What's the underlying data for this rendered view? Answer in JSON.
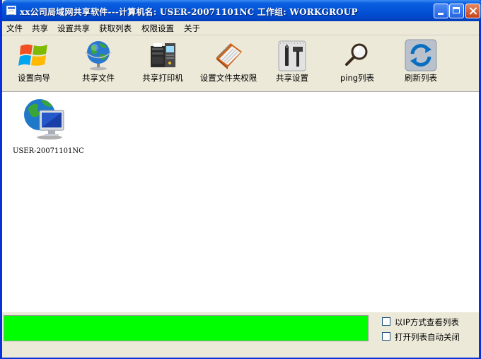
{
  "window": {
    "title": "xx公司局域网共享软件---计算机名: USER-20071101NC   工作组: WORKGROUP"
  },
  "menu": [
    "文件",
    "共享",
    "设置共享",
    "获取列表",
    "权限设置",
    "关于"
  ],
  "toolbar": [
    {
      "label": "设置向导",
      "icon": "windows-logo-icon"
    },
    {
      "label": "共享文件",
      "icon": "globe-icon"
    },
    {
      "label": "共享打印机",
      "icon": "printer-server-icon"
    },
    {
      "label": "设置文件夹权限",
      "icon": "notebook-icon"
    },
    {
      "label": "共享设置",
      "icon": "tools-icon"
    },
    {
      "label": "ping列表",
      "icon": "magnifier-icon"
    },
    {
      "label": "刷新列表",
      "icon": "refresh-icon"
    }
  ],
  "computers": [
    {
      "name": "USER-20071101NC",
      "icon": "network-computer-icon"
    }
  ],
  "status": {
    "progress_color": "#00ff00",
    "progress": 1.0,
    "options": [
      {
        "label": "以IP方式查看列表",
        "checked": false
      },
      {
        "label": "打开列表自动关闭",
        "checked": false
      }
    ]
  }
}
